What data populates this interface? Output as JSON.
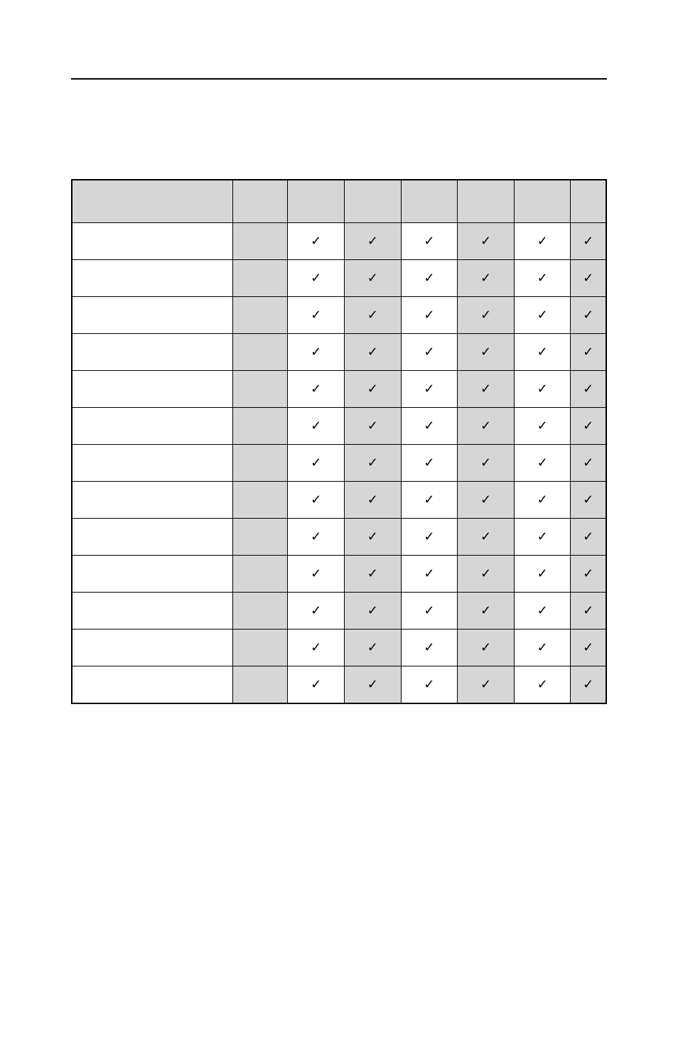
{
  "table": {
    "columns": [
      "",
      "",
      "",
      "",
      "",
      "",
      "",
      ""
    ],
    "rows": [
      {
        "label": "",
        "cells": [
          "✓",
          "✓",
          "✓",
          "✓",
          "✓",
          "✓"
        ]
      },
      {
        "label": "",
        "cells": [
          "✓",
          "✓",
          "✓",
          "✓",
          "✓",
          "✓"
        ]
      },
      {
        "label": "",
        "cells": [
          "✓",
          "✓",
          "✓",
          "✓",
          "✓",
          "✓"
        ]
      },
      {
        "label": "",
        "cells": [
          "✓",
          "✓",
          "✓",
          "✓",
          "✓",
          "✓"
        ]
      },
      {
        "label": "",
        "cells": [
          "✓",
          "✓",
          "✓",
          "✓",
          "✓",
          "✓"
        ]
      },
      {
        "label": "",
        "cells": [
          "✓",
          "✓",
          "✓",
          "✓",
          "✓",
          "✓"
        ]
      },
      {
        "label": "",
        "cells": [
          "✓",
          "✓",
          "✓",
          "✓",
          "✓",
          "✓"
        ]
      },
      {
        "label": "",
        "cells": [
          "✓",
          "✓",
          "✓",
          "✓",
          "✓",
          "✓"
        ],
        "section_start": true
      },
      {
        "label": "",
        "cells": [
          "✓",
          "✓",
          "✓",
          "✓",
          "✓",
          "✓"
        ]
      },
      {
        "label": "",
        "cells": [
          "✓",
          "✓",
          "✓",
          "✓",
          "✓",
          "✓"
        ]
      },
      {
        "label": "",
        "cells": [
          "✓",
          "✓",
          "✓",
          "✓",
          "✓",
          "✓"
        ]
      },
      {
        "label": "",
        "cells": [
          "✓",
          "✓",
          "✓",
          "✓",
          "✓",
          "✓"
        ]
      },
      {
        "label": "",
        "cells": [
          "✓",
          "✓",
          "✓",
          "✓",
          "✓",
          "✓"
        ]
      }
    ],
    "shaded_data_columns": [
      1,
      3,
      5
    ]
  }
}
